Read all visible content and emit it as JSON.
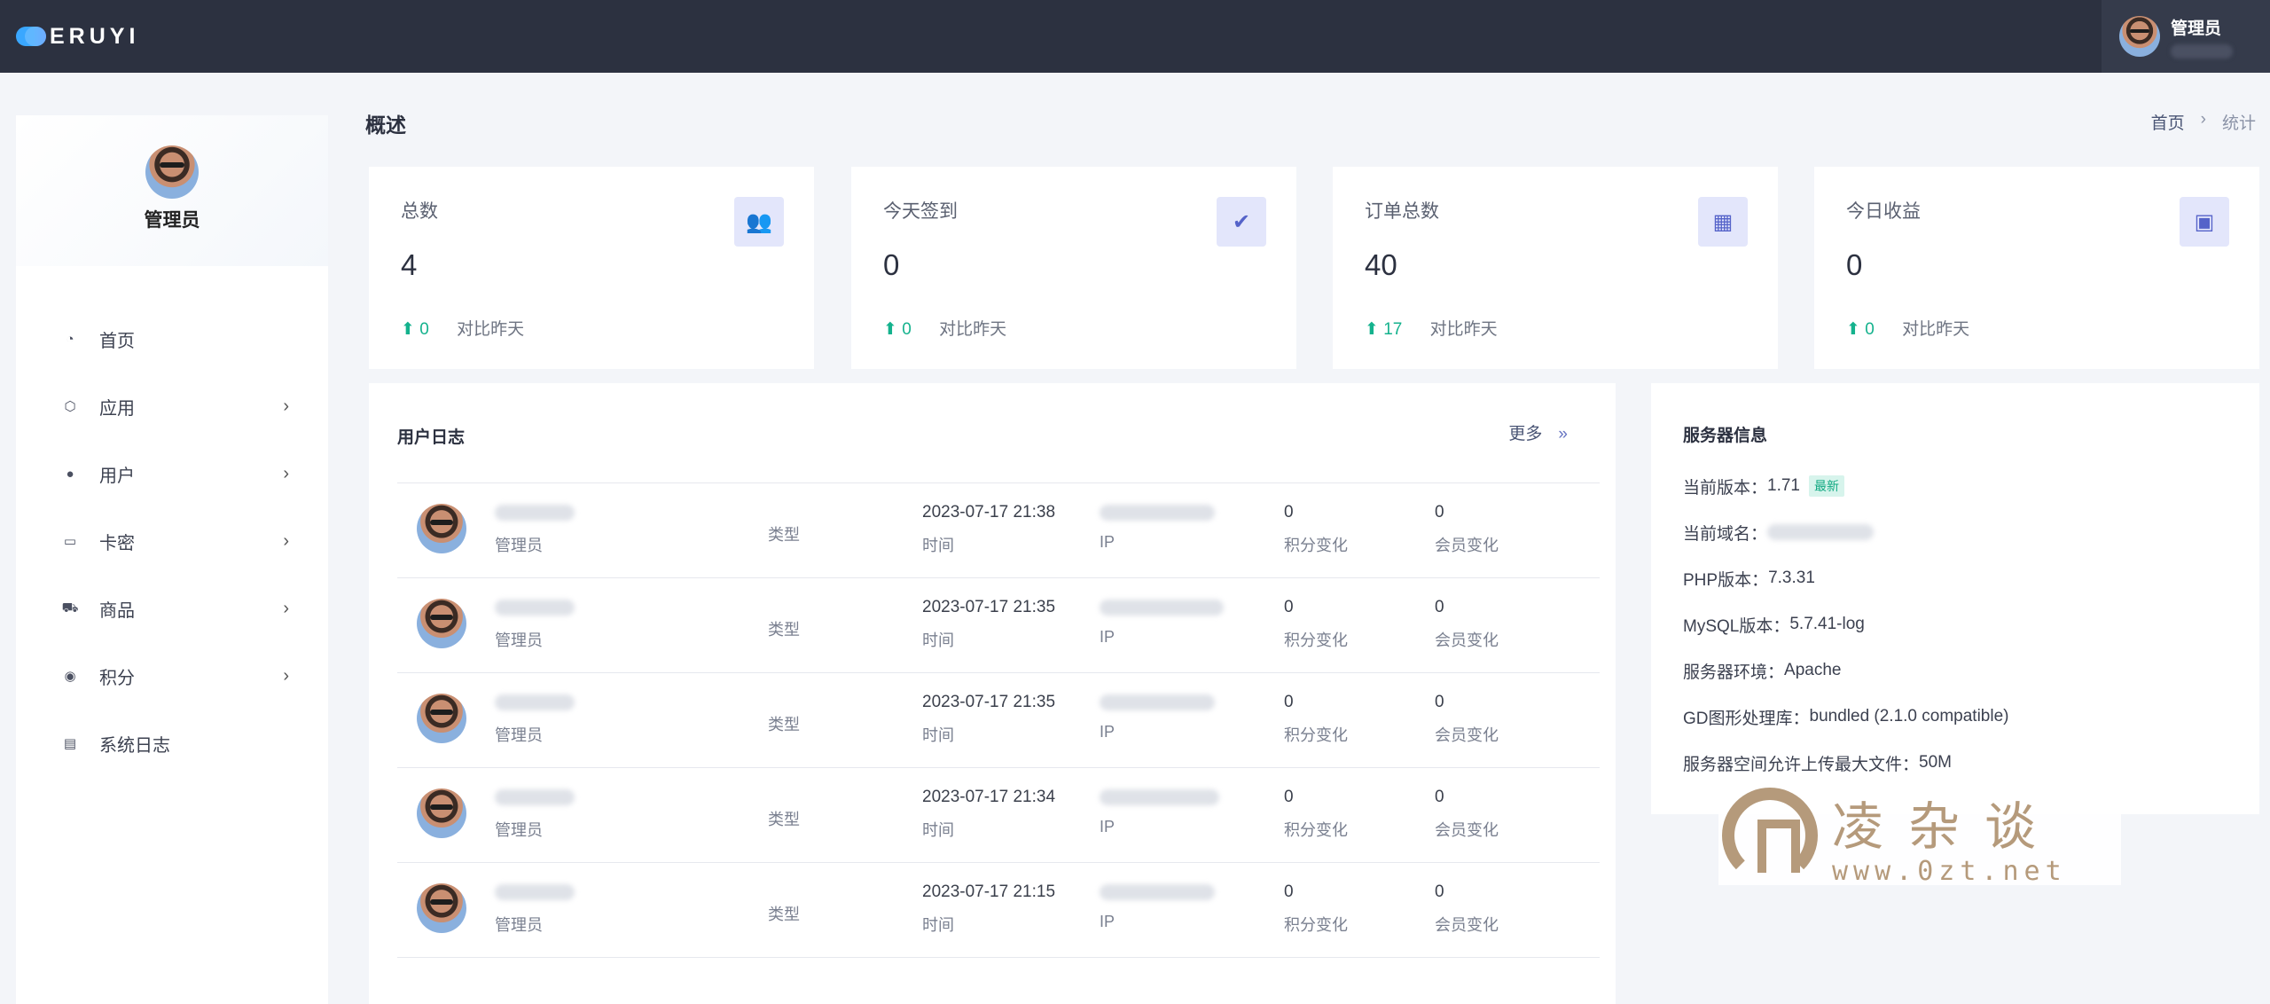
{
  "topbar": {
    "logo_text": "ERUYI",
    "user_name": "管理员"
  },
  "sidebar": {
    "profile_name": "管理员",
    "items": [
      {
        "label": "首页",
        "icon": "dashboard-icon",
        "has_children": false
      },
      {
        "label": "应用",
        "icon": "cube-icon",
        "has_children": true
      },
      {
        "label": "用户",
        "icon": "user-icon",
        "has_children": true
      },
      {
        "label": "卡密",
        "icon": "card-icon",
        "has_children": true
      },
      {
        "label": "商品",
        "icon": "cart-icon",
        "has_children": true
      },
      {
        "label": "积分",
        "icon": "coin-icon",
        "has_children": true
      },
      {
        "label": "系统日志",
        "icon": "log-icon",
        "has_children": false
      }
    ]
  },
  "header": {
    "title": "概述",
    "breadcrumb": [
      "首页",
      "›",
      "统计"
    ]
  },
  "stats": [
    {
      "label": "总数",
      "value": "4",
      "delta": "0",
      "compare": "对比昨天",
      "icon": "users-icon"
    },
    {
      "label": "今天签到",
      "value": "0",
      "delta": "0",
      "compare": "对比昨天",
      "icon": "checkin-icon"
    },
    {
      "label": "订单总数",
      "value": "40",
      "delta": "17",
      "compare": "对比昨天",
      "icon": "order-icon"
    },
    {
      "label": "今日收益",
      "value": "0",
      "delta": "0",
      "compare": "对比昨天",
      "icon": "money-icon"
    }
  ],
  "user_log": {
    "title": "用户日志",
    "more_label": "更多",
    "more_chevron": "»",
    "rows": [
      {
        "user_role": "管理员",
        "type_label": "类型",
        "time": "2023-07-17 21:38",
        "time_label": "时间",
        "ip_label": "IP",
        "score": "0",
        "score_label": "积分变化",
        "member": "0",
        "member_label": "会员变化"
      },
      {
        "user_role": "管理员",
        "type_label": "类型",
        "time": "2023-07-17 21:35",
        "time_label": "时间",
        "ip_label": "IP",
        "score": "0",
        "score_label": "积分变化",
        "member": "0",
        "member_label": "会员变化"
      },
      {
        "user_role": "管理员",
        "type_label": "类型",
        "time": "2023-07-17 21:35",
        "time_label": "时间",
        "ip_label": "IP",
        "score": "0",
        "score_label": "积分变化",
        "member": "0",
        "member_label": "会员变化"
      },
      {
        "user_role": "管理员",
        "type_label": "类型",
        "time": "2023-07-17 21:34",
        "time_label": "时间",
        "ip_label": "IP",
        "score": "0",
        "score_label": "积分变化",
        "member": "0",
        "member_label": "会员变化"
      },
      {
        "user_role": "管理员",
        "type_label": "类型",
        "time": "2023-07-17 21:15",
        "time_label": "时间",
        "ip_label": "IP",
        "score": "0",
        "score_label": "积分变化",
        "member": "0",
        "member_label": "会员变化"
      }
    ]
  },
  "server_info": {
    "title": "服务器信息",
    "version_label": "当前版本：",
    "version": "1.71",
    "version_badge": "最新",
    "domain_label": "当前域名：",
    "php_label": "PHP版本：",
    "php": "7.3.31",
    "mysql_label": "MySQL版本：",
    "mysql": "5.7.41-log",
    "env_label": "服务器环境：",
    "env": "Apache",
    "gd_label": "GD图形处理库：",
    "gd": "bundled (2.1.0 compatible)",
    "upload_label": "服务器空间允许上传最大文件：",
    "upload": "50M"
  },
  "watermark": {
    "text": "凌杂谈",
    "url": "www.0zt.net"
  },
  "colors": {
    "topbar": "#2c3140",
    "accent": "#5563c9",
    "trend_up": "#14b28d"
  }
}
